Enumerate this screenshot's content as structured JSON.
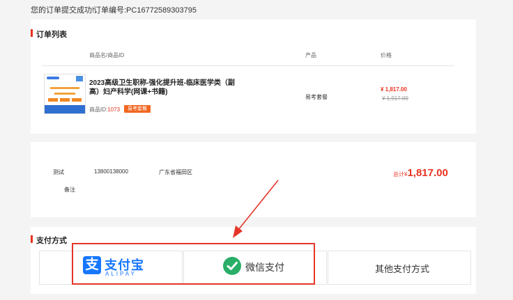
{
  "top": {
    "success": "您的订单提交成功!",
    "order_no": "订单编号:PC16772589303795"
  },
  "order_list": {
    "title": "订单列表",
    "headers": {
      "name": "商品名/商品ID",
      "product": "产品",
      "price": "价格"
    },
    "item": {
      "name": "2023高级卫生职称-强化提升班-临床医学类（副高）妇产科学(网课+书籍)",
      "id_label": "商品ID:",
      "id_value": "1073",
      "tag": "易考套餐",
      "product": "易考套餐",
      "price": "¥ 1,817.00",
      "original_price": "¥ 1,917.00"
    }
  },
  "contact": {
    "name": "测试",
    "phone": "13800138000",
    "address": "广东省福田区",
    "remark_label": "备注",
    "total_label": "总计¥",
    "total_amount": "1,817.00"
  },
  "payment": {
    "title": "支付方式",
    "alipay_cn": "支付宝",
    "alipay_en": "ALIPAY",
    "wechat": "微信支付",
    "other": "其他支付方式"
  },
  "colors": {
    "accent": "#e8331f",
    "alipay": "#1677ff",
    "wechat": "#2aae67"
  },
  "icons": [
    "alipay-logo-icon",
    "wechat-pay-icon",
    "red-arrow-icon"
  ]
}
